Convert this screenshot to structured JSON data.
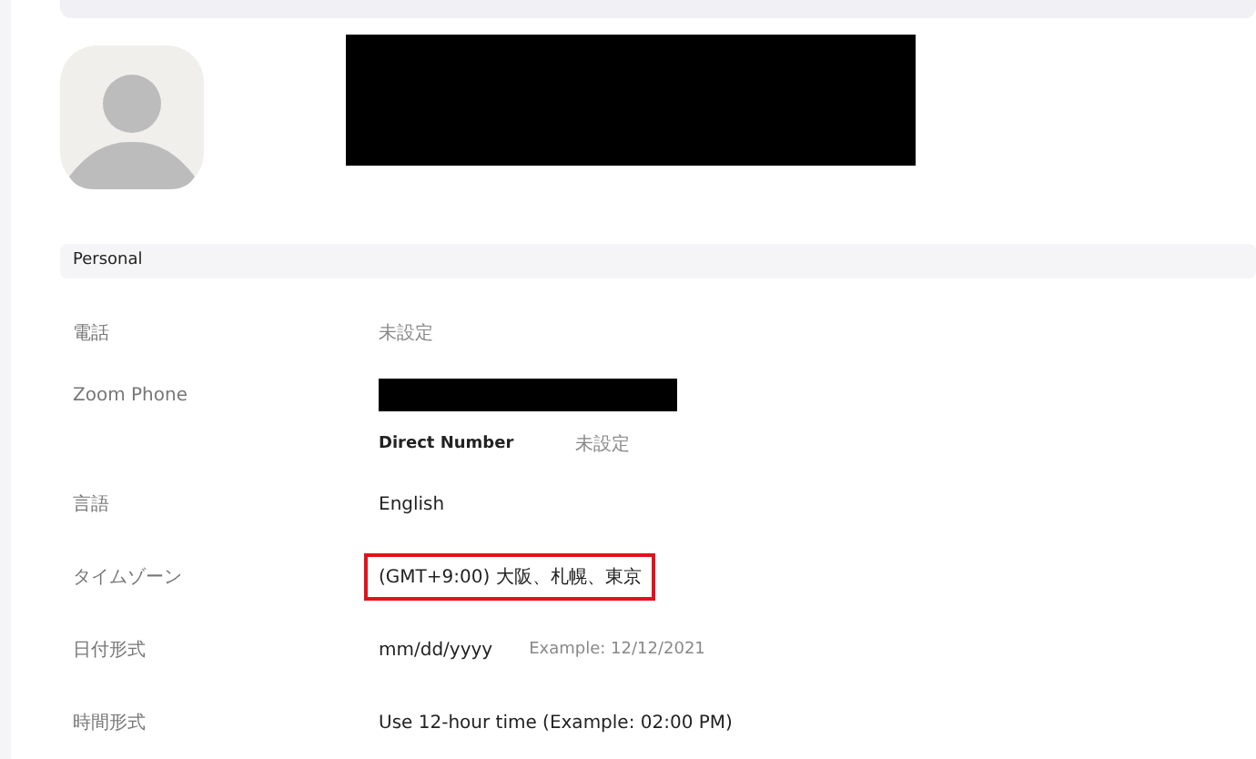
{
  "section": {
    "title": "Personal"
  },
  "rows": [
    {
      "kind": "field",
      "label": "電話",
      "value": "未設定",
      "muted": true,
      "highlighted": false
    },
    {
      "kind": "redacted",
      "label": "Zoom Phone"
    },
    {
      "kind": "sub",
      "label": "Direct Number",
      "value": "未設定",
      "muted": true
    },
    {
      "kind": "field",
      "label": "言語",
      "value": "English",
      "muted": false,
      "highlighted": false
    },
    {
      "kind": "field",
      "label": "タイムゾーン",
      "value": "(GMT+9:00) 大阪、札幌、東京",
      "muted": false,
      "highlighted": true
    },
    {
      "kind": "field",
      "label": "日付形式",
      "value": "mm/dd/yyyy",
      "example": "Example: 12/12/2021",
      "muted": false,
      "highlighted": false
    },
    {
      "kind": "field",
      "label": "時間形式",
      "value": "Use 12-hour time (Example: 02:00 PM)",
      "muted": false,
      "highlighted": false
    }
  ]
}
